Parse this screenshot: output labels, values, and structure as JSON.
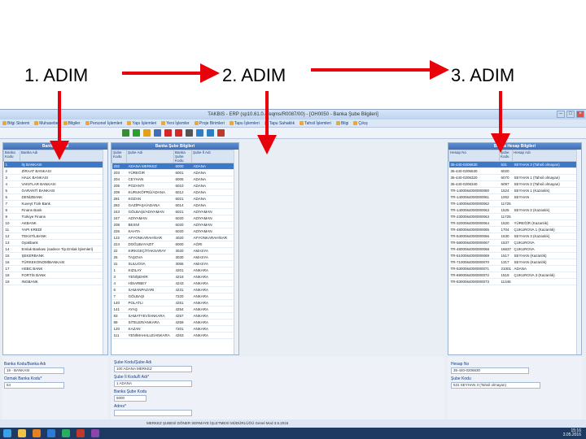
{
  "steps": [
    "1. ADIM",
    "2. ADIM",
    "3. ADIM"
  ],
  "colors": {
    "arrow": "#e8000b",
    "header": "#4a7cc3",
    "selected": "#3c78c8"
  },
  "window": {
    "title": "TAKBIS - ERP (sp10.61.0.4/eqms/R0087/00) - [OH0050 - Banka Şube Bilgileri]"
  },
  "menu": [
    "Bilgi Sistemi",
    "Muhasebe",
    "Bilgiler",
    "Personel İşlemleri",
    "Yapı İşlemleri",
    "Yeni İşlemler",
    "Proje Birimleri",
    "Tapu İşlemleri",
    "Tapu Sahaklık",
    "Tahsil İşlemleri",
    "Bilgi",
    "Çıkış"
  ],
  "toolbar_icons": [
    "refresh-icon",
    "add-icon",
    "edit-icon",
    "save-icon",
    "delete-icon",
    "cancel-icon",
    "print-icon",
    "filter-icon",
    "help-icon",
    "close-icon"
  ],
  "banks": {
    "title": "Banka Listesi",
    "headers": [
      "Banka Kodu",
      "Banka Adı"
    ],
    "rows": [
      [
        "1",
        "İŞ BANKASI"
      ],
      [
        "2",
        "ZİRAAT BANKASI"
      ],
      [
        "3",
        "HALK BANKASI"
      ],
      [
        "4",
        "VAKIFLAR BANKASI"
      ],
      [
        "5",
        "GARANTİ BANKASI"
      ],
      [
        "6",
        "DENİZBANK"
      ],
      [
        "7",
        "Kuveyt Türk Bank"
      ],
      [
        "8",
        "Finans Bank"
      ],
      [
        "9",
        "Türkiye Finans"
      ],
      [
        "10",
        "AKBANK"
      ],
      [
        "11",
        "YAPI KREDİ"
      ],
      [
        "12",
        "TEKSTİLBANK"
      ],
      [
        "13",
        "Oyakbank"
      ],
      [
        "14",
        "Emlak Bankası (sadece Tip.Emlak İşlemleri)"
      ],
      [
        "15",
        "ŞEKERBANK"
      ],
      [
        "16",
        "TÜRKEKONOMİBANKASI"
      ],
      [
        "17",
        "HSBC BANK"
      ],
      [
        "18",
        "FORTİS BANK"
      ],
      [
        "19",
        "INGBANK"
      ]
    ]
  },
  "branches": {
    "title": "Banka Şube Bilgileri",
    "headers": [
      "Şube Kodu",
      "Şube Adı",
      "Banka Şube Kodu",
      "Şube İl Adı"
    ],
    "rows": [
      [
        "202",
        "ADANA MERKEZ",
        "6000",
        "ADANA"
      ],
      [
        "203",
        "YÜREĞİR",
        "6001",
        "ADANA"
      ],
      [
        "204",
        "CEYHAN",
        "6006",
        "ADANA"
      ],
      [
        "205",
        "POZANTI",
        "6010",
        "ADANA"
      ],
      [
        "209",
        "KURUKÖPRÜ/ADANA",
        "6012",
        "ADANA"
      ],
      [
        "281",
        "KOZAN",
        "6021",
        "ADANA"
      ],
      [
        "282",
        "GAZİPAŞA/ADANA",
        "6014",
        "ADANA"
      ],
      [
        "243",
        "GÖLBAŞI/ADIYAMAN",
        "6021",
        "ADIYAMAN"
      ],
      [
        "247",
        "ADIYAMAN",
        "6020",
        "ADIYAMAN"
      ],
      [
        "208",
        "BESNİ",
        "6020",
        "ADIYAMAN"
      ],
      [
        "226",
        "KAHTA",
        "6020",
        "ADIYAMAN"
      ],
      [
        "122",
        "AFYONKARAHİSAR",
        "4020",
        "AFYONKARAHİSAR"
      ],
      [
        "224",
        "DOĞUBAYAZIT",
        "6000",
        "AĞRI"
      ],
      [
        "22",
        "KIRKGEÇİT/AKSARAY",
        "3020",
        "AMASYA"
      ],
      [
        "25",
        "TAŞOVA",
        "3030",
        "AMASYA"
      ],
      [
        "31",
        "SULUOVA",
        "3065",
        "AMASYA"
      ],
      [
        "1",
        "KIZILAY",
        "4201",
        "ANKARA"
      ],
      [
        "3",
        "YENİŞEHİR",
        "4218",
        "ANKARA"
      ],
      [
        "4",
        "HİSARBEY",
        "4243",
        "ANKARA"
      ],
      [
        "6",
        "SAMANPAZARI",
        "4231",
        "ANKARA"
      ],
      [
        "7",
        "GÖLBAŞI",
        "7220",
        "ANKARA"
      ],
      [
        "140",
        "POLATLI",
        "4251",
        "ANKARA"
      ],
      [
        "141",
        "AYAŞ",
        "4254",
        "ANKARA"
      ],
      [
        "83",
        "SAMATYEVİ/ANKARA",
        "4257",
        "ANKARA"
      ],
      [
        "89",
        "SİTELER/ANKARA",
        "4259",
        "ANKARA"
      ],
      [
        "120",
        "KAZAN",
        "7201",
        "ANKARA"
      ],
      [
        "111",
        "YENİMAHALLE/ANKARA",
        "4263",
        "ANKARA"
      ]
    ]
  },
  "accounts": {
    "title": "Banka Hesap Bilgileri",
    "headers": [
      "Hesap No",
      "Şube Kodu",
      "Hesap Adı"
    ],
    "rows": [
      [
        "35-440-0206630",
        "531",
        "SEYHAN 3 (Tahsil olmayan)"
      ],
      [
        "35-440-0206530",
        "6020",
        ""
      ],
      [
        "35-440-0206320",
        "6070",
        "SEYHAN 1 (Tahsil olmayan)"
      ],
      [
        "35-440-0206340",
        "6097",
        "SEYHAN 2 (Tahsil olmayan)"
      ],
      [
        "TR-1400064000000060",
        "1524",
        "SEYHAN 1 (Kazanlık)"
      ],
      [
        "TR-1400064000000061",
        "1002",
        "SEYHAN"
      ],
      [
        "TR-1400064000000062",
        "11725",
        ""
      ],
      [
        "TR-1400064000000063",
        "1525",
        "SEYHAN 2 (Kazanlık)"
      ],
      [
        "TR-2300064000000063",
        "11725",
        ""
      ],
      [
        "TR-3200064000000064",
        "1520",
        "YÜREĞİR (Kazanlık)"
      ],
      [
        "TR-4800064000000065",
        "1704",
        "ÇUKUROVA 1 (Kazanlık)"
      ],
      [
        "TR-5400064000000066",
        "1530",
        "SEYHAN 3 (Kazanlık)"
      ],
      [
        "TR-5800064000000067",
        "1537",
        "ÇUKUROVA"
      ],
      [
        "TR-4800064000000068",
        "16637",
        "ÇUKUROVA"
      ],
      [
        "TR-5100064000000069",
        "1517",
        "SEYHAN (Kazanlık)"
      ],
      [
        "TR-7100064000000070",
        "1317",
        "SEYHAN (Kazanlık)"
      ],
      [
        "TR-5300064000000071",
        "21001",
        "ADANA"
      ],
      [
        "TR-6900064000000072",
        "1519",
        "ÇUKUROVA 3 (Kazanlık)"
      ],
      [
        "TR-8300064000000073",
        "11346",
        ""
      ]
    ]
  },
  "form1": {
    "bank_code_label": "Banka Kodu/Banka Adı",
    "bank_code_value": "19 - BANKASI",
    "bank_name_label": "Ozmak Banka Kodu*",
    "bank_name_value": "54"
  },
  "form2": {
    "branch_label": "Şube Kodu/Şube Adı",
    "branch_value": "100    ADANA MERKEZ",
    "city_label": "Şube İl Kodu/İl Adı*",
    "city_value": "1    ADANA",
    "bank_branch_label": "Banka Şube Kodu",
    "bank_branch_value": "6000",
    "address_label": "Adres*",
    "address_value": ""
  },
  "form3": {
    "account_label": "Hesap No",
    "account_value": "35-440-0206630",
    "branch_code_label": "Şube Kodu",
    "branch_code_value": "531    SEYHAN 3 (Tahsil olmayan)"
  },
  "status": "MERKEZ ŞUBESİ        DÖNER SERMAYE İŞLETMESİ MÜDÜRLÜĞÜ    Genel Mod  3.5.2016",
  "clock": {
    "time": "15:16",
    "date": "3.05.2016"
  }
}
